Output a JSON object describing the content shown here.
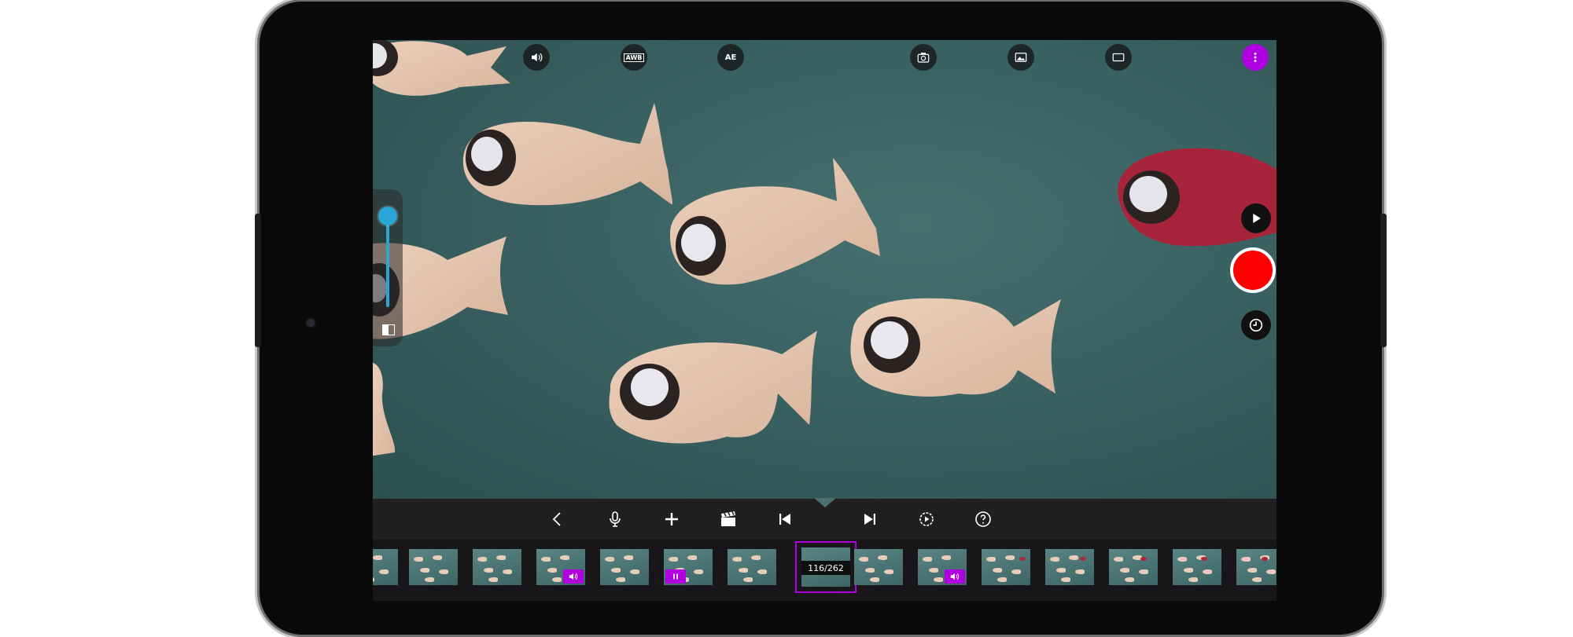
{
  "top_bar": {
    "buttons": [
      {
        "name": "volume-button",
        "icon": "speaker-icon",
        "label": ""
      },
      {
        "name": "white-balance-button",
        "icon": "awb-icon",
        "label": "AWB"
      },
      {
        "name": "auto-exposure-button",
        "icon": "ae-icon",
        "label": "AE"
      },
      {
        "name": "camera-switch-button",
        "icon": "camera-icon",
        "label": ""
      },
      {
        "name": "image-import-button",
        "icon": "image-icon",
        "label": ""
      },
      {
        "name": "aspect-ratio-button",
        "icon": "rectangle-icon",
        "label": ""
      },
      {
        "name": "more-menu-button",
        "icon": "more-vert-icon",
        "label": ""
      }
    ]
  },
  "zoom": {
    "level": 0.0
  },
  "right_controls": {
    "play": "play-icon",
    "record": "record-icon",
    "timer": "clock-icon"
  },
  "toolbar": {
    "tools": [
      {
        "name": "back-tool",
        "icon": "chevron-left-icon"
      },
      {
        "name": "mic-tool",
        "icon": "microphone-icon"
      },
      {
        "name": "add-tool",
        "icon": "plus-icon"
      },
      {
        "name": "clapper-tool",
        "icon": "clapperboard-icon"
      },
      {
        "name": "first-frame-tool",
        "icon": "skip-start-icon"
      },
      {
        "name": "last-frame-tool",
        "icon": "skip-end-icon"
      },
      {
        "name": "settings-tool",
        "icon": "settings-play-icon"
      },
      {
        "name": "help-tool",
        "icon": "help-icon"
      }
    ]
  },
  "filmstrip": {
    "current_frame": "116/262",
    "frames": [
      {
        "badge": ""
      },
      {
        "badge": ""
      },
      {
        "badge": ""
      },
      {
        "badge": "speaker"
      },
      {
        "badge": ""
      },
      {
        "badge": "pause"
      },
      {
        "badge": ""
      },
      {
        "badge": "current"
      },
      {
        "badge": ""
      },
      {
        "badge": "speaker"
      },
      {
        "badge": ""
      },
      {
        "badge": ""
      },
      {
        "badge": ""
      },
      {
        "badge": ""
      },
      {
        "badge": ""
      }
    ]
  },
  "colors": {
    "accent": "#b000e0",
    "record": "#ff0000",
    "zoom": "#2aa5d8"
  }
}
